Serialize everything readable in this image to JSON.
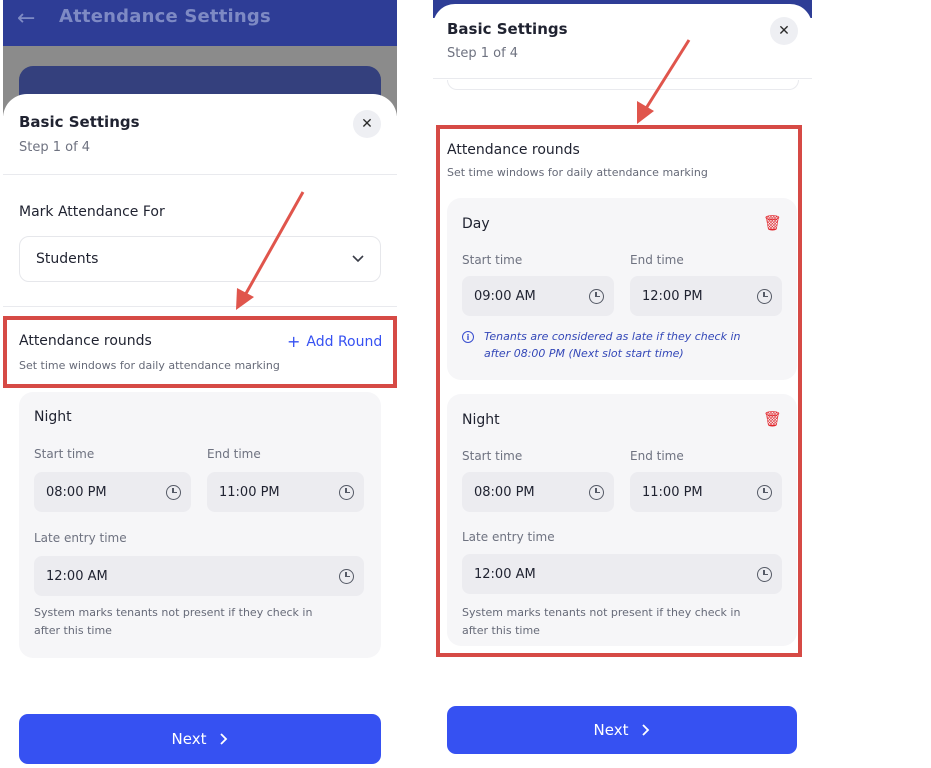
{
  "left": {
    "app_title": "Attendance Settings",
    "sheet": {
      "title": "Basic Settings",
      "step": "Step 1 of 4"
    },
    "mark_attendance": {
      "label": "Mark Attendance For",
      "value": "Students"
    },
    "rounds": {
      "title": "Attendance rounds",
      "subtitle": "Set time windows for daily attendance marking",
      "add_label": "Add Round"
    },
    "night": {
      "name": "Night",
      "start_label": "Start time",
      "start_value": "08:00 PM",
      "end_label": "End time",
      "end_value": "11:00 PM",
      "late_label": "Late entry time",
      "late_value": "12:00 AM",
      "helper_line1": "System marks tenants not present if they check in",
      "helper_line2": "after this time"
    },
    "next_label": "Next"
  },
  "right": {
    "sheet": {
      "title": "Basic Settings",
      "step": "Step 1 of 4"
    },
    "rounds": {
      "title": "Attendance rounds",
      "subtitle": "Set time windows for daily attendance marking"
    },
    "day": {
      "name": "Day",
      "start_label": "Start time",
      "start_value": "09:00 AM",
      "end_label": "End time",
      "end_value": "12:00 PM",
      "info_line1": "Tenants are considered as late if they check in",
      "info_line2": "after 08:00 PM (Next slot start time)"
    },
    "night": {
      "name": "Night",
      "start_label": "Start time",
      "start_value": "08:00 PM",
      "end_label": "End time",
      "end_value": "11:00 PM",
      "late_label": "Late entry time",
      "late_value": "12:00 AM",
      "helper_line1": "System marks tenants not present if they check in",
      "helper_line2": "after this time"
    },
    "next_label": "Next"
  },
  "colors": {
    "header_bg": "#2e3d96",
    "primary": "#3651f2",
    "highlight": "#d64a45",
    "delete": "#e2262c",
    "info": "#3448b8"
  },
  "icons": [
    "back-arrow-icon",
    "close-icon",
    "chevron-down-icon",
    "plus-icon",
    "clock-icon",
    "trash-icon",
    "info-icon",
    "chevron-right-icon",
    "annotation-arrow"
  ]
}
